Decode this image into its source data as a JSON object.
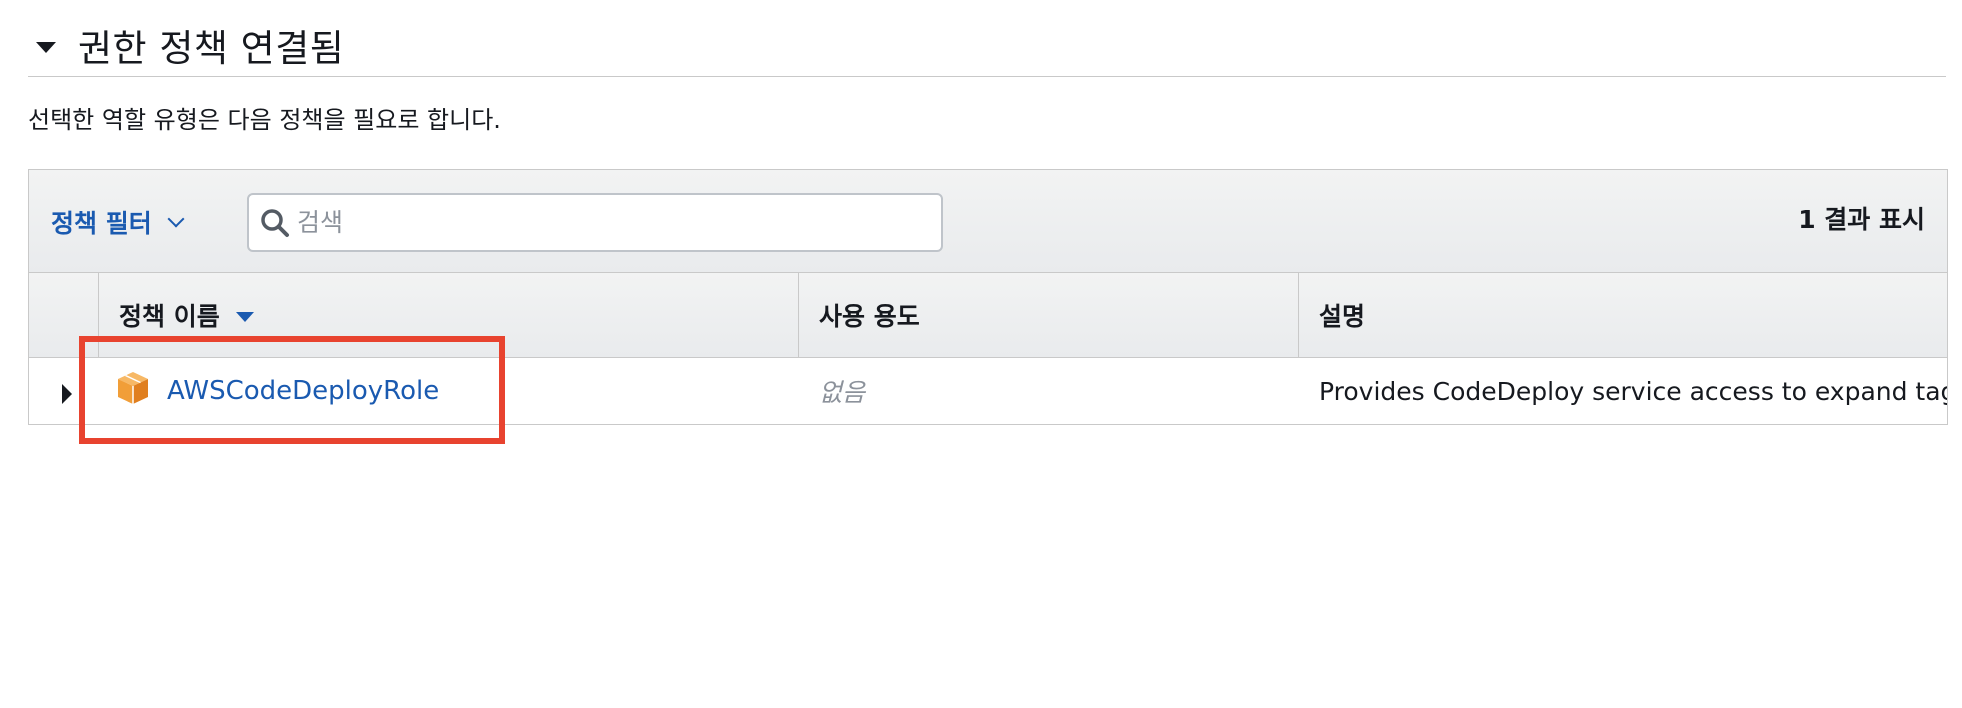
{
  "section": {
    "title": "권한 정책 연결됨",
    "description": "선택한 역할 유형은 다음 정책을 필요로 합니다."
  },
  "toolbar": {
    "filter_label": "정책 필터",
    "search_placeholder": "검색",
    "search_value": "",
    "result_count": "1 결과 표시"
  },
  "table": {
    "headers": {
      "name": "정책 이름",
      "usage": "사용 용도",
      "description": "설명"
    },
    "rows": [
      {
        "name": "AWSCodeDeployRole",
        "usage": "없음",
        "description": "Provides CodeDeploy service access to expand tags and interact with Auto Scaling on your behalf."
      }
    ]
  },
  "icons": {
    "section_toggle": "caret-down-icon",
    "filter_toggle": "chevron-down-icon",
    "search": "search-icon",
    "sort": "sort-desc-icon",
    "row_expand": "caret-right-icon",
    "policy_type": "aws-managed-policy-icon"
  },
  "colors": {
    "link": "#1a5ab0",
    "highlight": "#e8432f",
    "policy_icon": "#f19e38"
  }
}
